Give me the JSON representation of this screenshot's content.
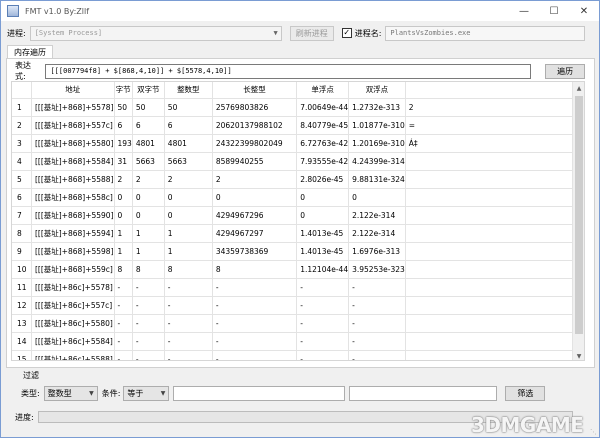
{
  "window": {
    "title": "FMT v1.0 By:Zllf",
    "controls": [
      "minimize",
      "maximize",
      "close"
    ]
  },
  "process_row": {
    "label": "进程:",
    "process_value": "[System Process]",
    "refresh_button": "刷新进程",
    "select_name_checked": true,
    "select_name_label": "进程名:",
    "process_name_value": "PlantsVsZombies.exe"
  },
  "tabs": [
    {
      "label": "内存遍历",
      "active": true
    }
  ],
  "expression_row": {
    "label": "表达式:",
    "value": "[[[007794f8] + $[868,4,10]] + $[5578,4,10]]",
    "traverse_button": "遍历"
  },
  "table": {
    "headers": [
      "",
      "地址",
      "字节",
      "双字节",
      "整数型",
      "长整型",
      "单浮点",
      "双浮点",
      ""
    ],
    "rows": [
      [
        "1",
        "[[[基址]+868]+5578]",
        "50",
        "50",
        "50",
        "25769803826",
        "7.00649e-44",
        "1.2732e-313",
        "2"
      ],
      [
        "2",
        "[[[基址]+868]+557c]",
        "6",
        "6",
        "6",
        "20620137988102",
        "8.40779e-45",
        "1.01877e-310",
        "="
      ],
      [
        "3",
        "[[[基址]+868]+5580]",
        "193",
        "4801",
        "4801",
        "24322399802049",
        "6.72763e-42",
        "1.20169e-310",
        "Á‡"
      ],
      [
        "4",
        "[[[基址]+868]+5584]",
        "31",
        "5663",
        "5663",
        "8589940255",
        "7.93555e-42",
        "4.24399e-314",
        "\u001f\u0016"
      ],
      [
        "5",
        "[[[基址]+868]+5588]",
        "2",
        "2",
        "2",
        "2",
        "2.8026e-45",
        "9.88131e-324",
        ""
      ],
      [
        "6",
        "[[[基址]+868]+558c]",
        "0",
        "0",
        "0",
        "0",
        "0",
        "0",
        ""
      ],
      [
        "7",
        "[[[基址]+868]+5590]",
        "0",
        "0",
        "0",
        "4294967296",
        "0",
        "2.122e-314",
        ""
      ],
      [
        "8",
        "[[[基址]+868]+5594]",
        "1",
        "1",
        "1",
        "4294967297",
        "1.4013e-45",
        "2.122e-314",
        "\u0001"
      ],
      [
        "9",
        "[[[基址]+868]+5598]",
        "1",
        "1",
        "1",
        "34359738369",
        "1.4013e-45",
        "1.6976e-313",
        "\u0001"
      ],
      [
        "10",
        "[[[基址]+868]+559c]",
        "8",
        "8",
        "8",
        "8",
        "1.12104e-44",
        "3.95253e-323",
        ""
      ],
      [
        "11",
        "[[[基址]+86c]+5578]",
        "-",
        "-",
        "-",
        "-",
        "-",
        "-",
        ""
      ],
      [
        "12",
        "[[[基址]+86c]+557c]",
        "-",
        "-",
        "-",
        "-",
        "-",
        "-",
        ""
      ],
      [
        "13",
        "[[[基址]+86c]+5580]",
        "-",
        "-",
        "-",
        "-",
        "-",
        "-",
        ""
      ],
      [
        "14",
        "[[[基址]+86c]+5584]",
        "-",
        "-",
        "-",
        "-",
        "-",
        "-",
        ""
      ],
      [
        "15",
        "[[[基址]+86c]+5588]",
        "-",
        "-",
        "-",
        "-",
        "-",
        "-",
        ""
      ]
    ]
  },
  "filter": {
    "group_label": "过滤",
    "type_label": "类型:",
    "type_value": "整数型",
    "condition_label": "条件:",
    "condition_value": "等于",
    "value_a": "",
    "value_b": "",
    "filter_button": "筛选"
  },
  "progress": {
    "label": "进度:",
    "value": 0
  },
  "watermark": {
    "text": "3DMGAME"
  },
  "colors": {
    "progress_fill": "#06b025",
    "window_border": "#7a9cd3"
  }
}
